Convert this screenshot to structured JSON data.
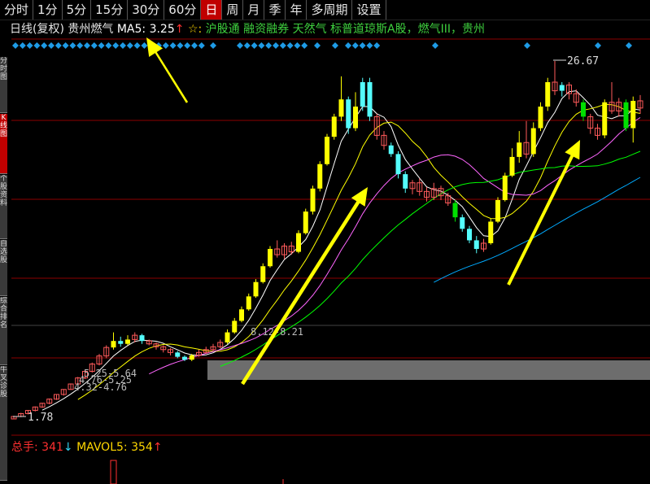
{
  "toolbar": {
    "buttons": [
      "分时",
      "1分",
      "5分",
      "15分",
      "30分",
      "60分",
      "日",
      "周",
      "月",
      "季",
      "年",
      "多周期",
      "设置"
    ],
    "active": "日"
  },
  "side_tabs": [
    {
      "label": "分时图",
      "active": false
    },
    {
      "label": "K线图",
      "active": true
    },
    {
      "label": "个股资料",
      "active": false
    },
    {
      "label": "自选股",
      "active": false
    },
    {
      "label": "综合排名",
      "active": false
    },
    {
      "label": "牛叉诊股",
      "active": false
    }
  ],
  "header": {
    "chart_type": "日线(复权)",
    "stock_name": "贵州燃气",
    "ma_label": "MA5:",
    "ma_value": "3.25",
    "ma_arrow": "↑",
    "star": "☆:",
    "concepts": "沪股通 融资融券 天然气 标普道琼斯A股，燃气III，贵州"
  },
  "volume_header": {
    "label": "总手:",
    "value": "341",
    "arrow_down": "↓",
    "mavol_label": "MAVOL5:",
    "mavol_value": "354",
    "arrow_up": "↑"
  },
  "colors": {
    "bull": "#ffff00",
    "bear": "#54fcfc",
    "green_bar": "#00e000",
    "ma5": "#ffffff",
    "ma10": "#ffff00",
    "ma20": "#ff66ff",
    "ma30": "#00ff00",
    "ma60": "#00aaff",
    "arrow": "#ffff00",
    "diamond": "#1e9be6",
    "grid": "#8b0000",
    "band": "#808080"
  },
  "chart_data": {
    "type": "candlestick",
    "price_labels": {
      "high": "26.67",
      "low": "1.78"
    },
    "annotations": [
      "8.12-8.21",
      "5.25-5.64",
      "4.76-5.25",
      "4.32-4.76"
    ],
    "candles": [
      {
        "o": 1.78,
        "c": 1.95,
        "h": 2.0,
        "l": 1.78,
        "t": "doji"
      },
      {
        "o": 1.95,
        "c": 2.15,
        "h": 2.2,
        "l": 1.9,
        "t": "doji"
      },
      {
        "o": 2.15,
        "c": 2.37,
        "h": 2.4,
        "l": 2.1,
        "t": "doji"
      },
      {
        "o": 2.37,
        "c": 2.61,
        "h": 2.65,
        "l": 2.3,
        "t": "doji"
      },
      {
        "o": 2.61,
        "c": 2.87,
        "h": 2.9,
        "l": 2.55,
        "t": "doji"
      },
      {
        "o": 2.87,
        "c": 3.16,
        "h": 3.2,
        "l": 2.8,
        "t": "doji"
      },
      {
        "o": 3.16,
        "c": 3.48,
        "h": 3.5,
        "l": 3.1,
        "t": "doji"
      },
      {
        "o": 3.48,
        "c": 3.83,
        "h": 3.85,
        "l": 3.4,
        "t": "doji"
      },
      {
        "o": 3.83,
        "c": 4.21,
        "h": 4.25,
        "l": 3.8,
        "t": "doji"
      },
      {
        "o": 4.21,
        "c": 4.63,
        "h": 4.7,
        "l": 4.15,
        "t": "doji"
      },
      {
        "o": 4.63,
        "c": 5.09,
        "h": 5.2,
        "l": 4.55,
        "t": "doji"
      },
      {
        "o": 5.09,
        "c": 5.6,
        "h": 5.7,
        "l": 5.0,
        "t": "doji"
      },
      {
        "o": 5.6,
        "c": 6.16,
        "h": 6.3,
        "l": 5.5,
        "t": "doji"
      },
      {
        "o": 6.16,
        "c": 6.75,
        "h": 6.9,
        "l": 6.0,
        "t": "doji"
      },
      {
        "o": 6.75,
        "c": 7.2,
        "h": 7.8,
        "l": 6.6,
        "t": "bull"
      },
      {
        "o": 7.2,
        "c": 7.0,
        "h": 7.5,
        "l": 6.8,
        "t": "bear"
      },
      {
        "o": 7.0,
        "c": 7.3,
        "h": 7.6,
        "l": 6.9,
        "t": "bull"
      },
      {
        "o": 7.3,
        "c": 7.6,
        "h": 7.8,
        "l": 7.1,
        "t": "doji"
      },
      {
        "o": 7.6,
        "c": 7.2,
        "h": 7.7,
        "l": 7.0,
        "t": "bear"
      },
      {
        "o": 7.2,
        "c": 7.0,
        "h": 7.3,
        "l": 6.9,
        "t": "doji"
      },
      {
        "o": 7.0,
        "c": 6.8,
        "h": 7.1,
        "l": 6.6,
        "t": "doji"
      },
      {
        "o": 6.8,
        "c": 6.6,
        "h": 6.9,
        "l": 6.4,
        "t": "doji"
      },
      {
        "o": 6.6,
        "c": 6.4,
        "h": 6.7,
        "l": 6.2,
        "t": "doji"
      },
      {
        "o": 6.4,
        "c": 6.1,
        "h": 6.5,
        "l": 6.0,
        "t": "bear"
      },
      {
        "o": 6.1,
        "c": 5.9,
        "h": 6.2,
        "l": 5.8,
        "t": "bear"
      },
      {
        "o": 5.9,
        "c": 6.2,
        "h": 6.3,
        "l": 5.8,
        "t": "bull"
      },
      {
        "o": 6.2,
        "c": 6.4,
        "h": 6.6,
        "l": 6.1,
        "t": "doji"
      },
      {
        "o": 6.4,
        "c": 6.6,
        "h": 6.8,
        "l": 6.3,
        "t": "doji"
      },
      {
        "o": 6.6,
        "c": 6.8,
        "h": 7.0,
        "l": 6.5,
        "t": "doji"
      },
      {
        "o": 6.8,
        "c": 7.1,
        "h": 7.3,
        "l": 6.7,
        "t": "doji"
      },
      {
        "o": 7.1,
        "c": 7.8,
        "h": 8.0,
        "l": 7.0,
        "t": "bull"
      },
      {
        "o": 7.8,
        "c": 8.6,
        "h": 8.8,
        "l": 7.7,
        "t": "bull"
      },
      {
        "o": 8.6,
        "c": 9.4,
        "h": 9.6,
        "l": 8.5,
        "t": "bull"
      },
      {
        "o": 9.4,
        "c": 10.3,
        "h": 10.5,
        "l": 9.3,
        "t": "bull"
      },
      {
        "o": 10.3,
        "c": 11.3,
        "h": 11.5,
        "l": 10.2,
        "t": "bull"
      },
      {
        "o": 11.3,
        "c": 12.4,
        "h": 12.6,
        "l": 11.2,
        "t": "bull"
      },
      {
        "o": 12.4,
        "c": 13.6,
        "h": 13.8,
        "l": 12.3,
        "t": "bull"
      },
      {
        "o": 13.6,
        "c": 13.2,
        "h": 14.2,
        "l": 13.0,
        "t": "doji"
      },
      {
        "o": 13.2,
        "c": 13.8,
        "h": 14.0,
        "l": 12.9,
        "t": "doji"
      },
      {
        "o": 13.8,
        "c": 13.4,
        "h": 14.1,
        "l": 13.2,
        "t": "doji"
      },
      {
        "o": 13.4,
        "c": 14.7,
        "h": 14.9,
        "l": 13.3,
        "t": "bull"
      },
      {
        "o": 14.7,
        "c": 16.2,
        "h": 16.4,
        "l": 14.6,
        "t": "bull"
      },
      {
        "o": 16.2,
        "c": 17.8,
        "h": 18.0,
        "l": 16.0,
        "t": "bull"
      },
      {
        "o": 17.8,
        "c": 19.5,
        "h": 19.7,
        "l": 17.6,
        "t": "bull"
      },
      {
        "o": 19.5,
        "c": 21.4,
        "h": 21.6,
        "l": 19.4,
        "t": "bull"
      },
      {
        "o": 21.4,
        "c": 22.8,
        "h": 23.0,
        "l": 21.2,
        "t": "bull"
      },
      {
        "o": 22.8,
        "c": 24.0,
        "h": 25.6,
        "l": 22.5,
        "t": "bull"
      },
      {
        "o": 24.0,
        "c": 22.0,
        "h": 24.2,
        "l": 21.6,
        "t": "bear"
      },
      {
        "o": 22.0,
        "c": 23.5,
        "h": 24.5,
        "l": 21.8,
        "t": "bull"
      },
      {
        "o": 23.5,
        "c": 25.2,
        "h": 25.5,
        "l": 23.2,
        "t": "bear"
      },
      {
        "o": 25.2,
        "c": 22.8,
        "h": 25.5,
        "l": 22.5,
        "t": "bear"
      },
      {
        "o": 22.8,
        "c": 21.5,
        "h": 23.0,
        "l": 21.2,
        "t": "doji"
      },
      {
        "o": 21.5,
        "c": 20.8,
        "h": 21.8,
        "l": 20.5,
        "t": "doji"
      },
      {
        "o": 20.8,
        "c": 20.2,
        "h": 21.0,
        "l": 20.0,
        "t": "bear"
      },
      {
        "o": 20.2,
        "c": 18.8,
        "h": 20.4,
        "l": 18.5,
        "t": "bear"
      },
      {
        "o": 18.8,
        "c": 17.8,
        "h": 19.0,
        "l": 17.5,
        "t": "bear"
      },
      {
        "o": 17.8,
        "c": 18.2,
        "h": 18.4,
        "l": 17.4,
        "t": "doji"
      },
      {
        "o": 18.2,
        "c": 17.6,
        "h": 18.5,
        "l": 17.3,
        "t": "doji"
      },
      {
        "o": 17.6,
        "c": 17.2,
        "h": 17.9,
        "l": 16.9,
        "t": "doji"
      },
      {
        "o": 17.2,
        "c": 17.8,
        "h": 18.2,
        "l": 17.0,
        "t": "doji"
      },
      {
        "o": 17.8,
        "c": 17.3,
        "h": 18.0,
        "l": 17.0,
        "t": "doji"
      },
      {
        "o": 17.3,
        "c": 16.8,
        "h": 17.5,
        "l": 16.6,
        "t": "doji"
      },
      {
        "o": 16.8,
        "c": 15.8,
        "h": 17.0,
        "l": 15.5,
        "t": "green"
      },
      {
        "o": 15.8,
        "c": 15.0,
        "h": 16.0,
        "l": 14.8,
        "t": "bear"
      },
      {
        "o": 15.0,
        "c": 14.2,
        "h": 15.2,
        "l": 14.0,
        "t": "bear"
      },
      {
        "o": 14.2,
        "c": 13.6,
        "h": 14.5,
        "l": 13.3,
        "t": "bear"
      },
      {
        "o": 13.6,
        "c": 14.0,
        "h": 14.3,
        "l": 13.4,
        "t": "doji"
      },
      {
        "o": 14.0,
        "c": 15.5,
        "h": 15.7,
        "l": 13.9,
        "t": "bull"
      },
      {
        "o": 15.5,
        "c": 17.0,
        "h": 17.2,
        "l": 15.4,
        "t": "bull"
      },
      {
        "o": 17.0,
        "c": 18.7,
        "h": 18.9,
        "l": 16.9,
        "t": "bull"
      },
      {
        "o": 18.7,
        "c": 20.0,
        "h": 20.6,
        "l": 18.6,
        "t": "bull"
      },
      {
        "o": 20.0,
        "c": 21.0,
        "h": 21.8,
        "l": 19.6,
        "t": "bull"
      },
      {
        "o": 21.0,
        "c": 20.2,
        "h": 22.5,
        "l": 19.9,
        "t": "doji"
      },
      {
        "o": 20.2,
        "c": 22.0,
        "h": 22.4,
        "l": 20.0,
        "t": "bull"
      },
      {
        "o": 22.0,
        "c": 23.5,
        "h": 23.8,
        "l": 21.8,
        "t": "bull"
      },
      {
        "o": 23.5,
        "c": 25.2,
        "h": 25.5,
        "l": 23.2,
        "t": "bull"
      },
      {
        "o": 25.2,
        "c": 24.6,
        "h": 26.67,
        "l": 24.3,
        "t": "doji"
      },
      {
        "o": 24.6,
        "c": 25.0,
        "h": 25.2,
        "l": 24.2,
        "t": "bear"
      },
      {
        "o": 25.0,
        "c": 24.4,
        "h": 25.2,
        "l": 24.0,
        "t": "doji"
      },
      {
        "o": 24.4,
        "c": 23.8,
        "h": 24.7,
        "l": 23.5,
        "t": "doji"
      },
      {
        "o": 23.8,
        "c": 22.8,
        "h": 24.0,
        "l": 22.5,
        "t": "green"
      },
      {
        "o": 22.8,
        "c": 22.0,
        "h": 23.0,
        "l": 21.6,
        "t": "doji"
      },
      {
        "o": 22.0,
        "c": 21.5,
        "h": 22.3,
        "l": 21.2,
        "t": "doji"
      },
      {
        "o": 21.5,
        "c": 23.8,
        "h": 24.0,
        "l": 21.3,
        "t": "bull"
      },
      {
        "o": 23.8,
        "c": 23.2,
        "h": 25.2,
        "l": 23.0,
        "t": "doji"
      },
      {
        "o": 23.2,
        "c": 23.8,
        "h": 24.1,
        "l": 22.8,
        "t": "doji"
      },
      {
        "o": 23.8,
        "c": 22.0,
        "h": 24.0,
        "l": 21.8,
        "t": "green"
      },
      {
        "o": 22.0,
        "c": 23.9,
        "h": 24.2,
        "l": 21.0,
        "t": "bull"
      },
      {
        "o": 23.9,
        "c": 23.4,
        "h": 24.3,
        "l": 23.0,
        "t": "doji"
      }
    ],
    "volume_bars": [
      0,
      0,
      0,
      0,
      0,
      0,
      0,
      0,
      0,
      0,
      0,
      0,
      0,
      0,
      0,
      0,
      0,
      0,
      0,
      0,
      0,
      0,
      0,
      0,
      0,
      0,
      0,
      0,
      0,
      0,
      0,
      0,
      0,
      0,
      0,
      0,
      0,
      0,
      0,
      0,
      0,
      0,
      0,
      0,
      0,
      0,
      0,
      0,
      0,
      0,
      0,
      0,
      0,
      0,
      0,
      0,
      0,
      0,
      0,
      0,
      0,
      0,
      0,
      0,
      0,
      0,
      0,
      0,
      0,
      0,
      0,
      0,
      0,
      0,
      0,
      0,
      0,
      0,
      0,
      0,
      0,
      0,
      0,
      0,
      0,
      0,
      0,
      0,
      0
    ]
  }
}
